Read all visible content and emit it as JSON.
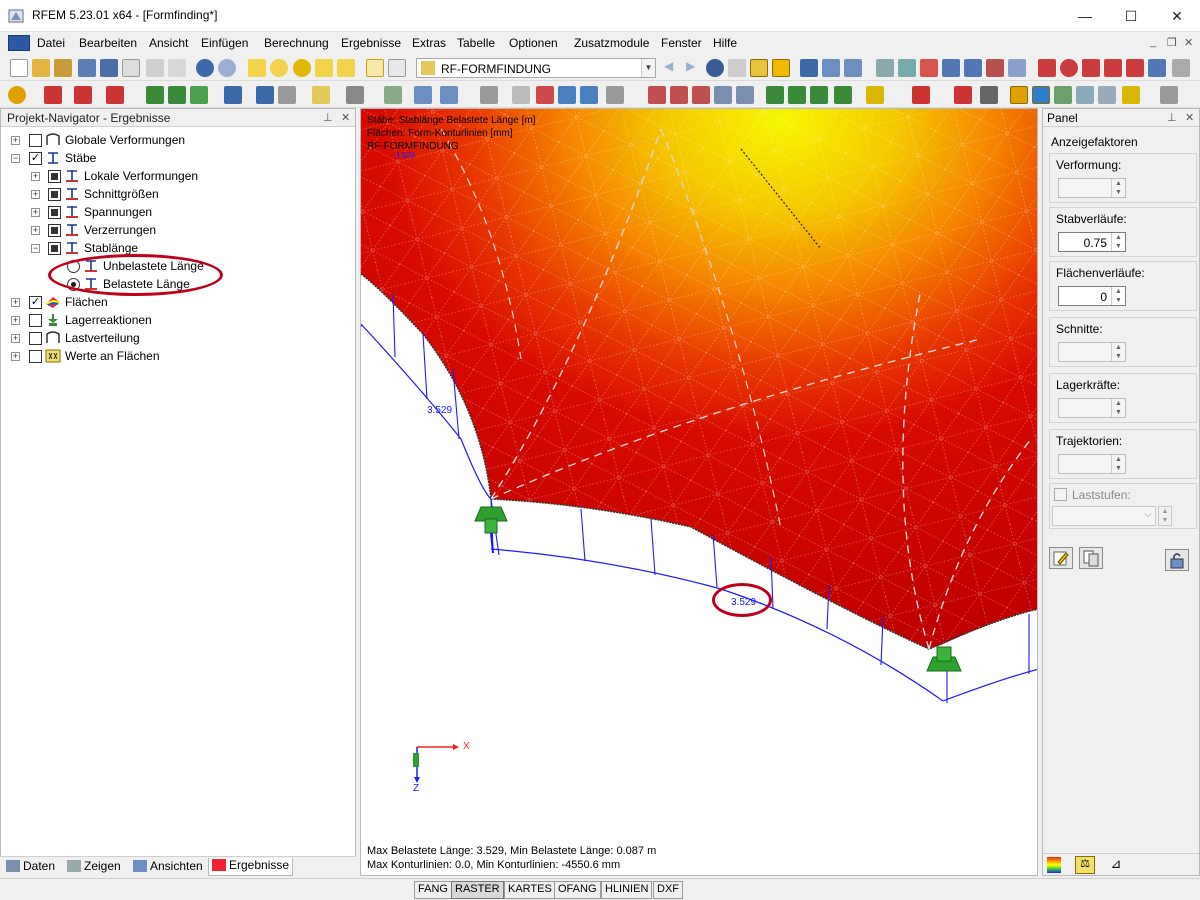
{
  "window": {
    "title": "RFEM 5.23.01 x64 - [Formfinding*]",
    "minimize": "—",
    "maximize": "☐",
    "close": "✕"
  },
  "menu": {
    "items": [
      "Datei",
      "Bearbeiten",
      "Ansicht",
      "Einfügen",
      "Berechnung",
      "Ergebnisse",
      "Extras",
      "Tabelle",
      "Optionen",
      "Zusatzmodule",
      "Fenster",
      "Hilfe"
    ]
  },
  "toolbar": {
    "module_combo": "RF-FORMFINDUNG"
  },
  "navigator": {
    "title": "Projekt-Navigator - Ergebnisse",
    "items": [
      {
        "label": "Globale Verformungen"
      },
      {
        "label": "Stäbe"
      },
      {
        "label": "Lokale Verformungen"
      },
      {
        "label": "Schnittgrößen"
      },
      {
        "label": "Spannungen"
      },
      {
        "label": "Verzerrungen"
      },
      {
        "label": "Stablänge"
      },
      {
        "label": "Unbelastete Länge"
      },
      {
        "label": "Belastete Länge"
      },
      {
        "label": "Flächen"
      },
      {
        "label": "Lagerreaktionen"
      },
      {
        "label": "Lastverteilung"
      },
      {
        "label": "Werte an Flächen"
      }
    ],
    "tabs": [
      "Daten",
      "Zeigen",
      "Ansichten",
      "Ergebnisse"
    ]
  },
  "viewport": {
    "info_lines": [
      "Stäbe: Stablänge Belastete Länge [m]",
      "Flächen: Form-Konturlinien [mm]",
      "RF-FORMFINDUNG"
    ],
    "info_small": "3.529",
    "value_label_1": "3.529",
    "value_label_2": "3.529",
    "axis_x": "X",
    "axis_z": "Z",
    "stat_line_1": "Max Belastete Länge: 3.529, Min Belastete Länge: 0.087 m",
    "stat_line_2": "Max Konturlinien: 0.0, Min Konturlinien: -4550.6 mm"
  },
  "panel": {
    "title": "Panel",
    "subtitle": "Anzeigefaktoren",
    "groups": [
      {
        "label": "Verformung:",
        "value": ""
      },
      {
        "label": "Stabverläufe:",
        "value": "0.75"
      },
      {
        "label": "Flächenverläufe:",
        "value": "0"
      },
      {
        "label": "Schnitte:",
        "value": ""
      },
      {
        "label": "Lagerkräfte:",
        "value": ""
      },
      {
        "label": "Trajektorien:",
        "value": ""
      },
      {
        "label": "Laststufen:",
        "value": ""
      }
    ]
  },
  "statusbar": {
    "items": [
      "FANG",
      "RASTER",
      "KARTES",
      "OFANG",
      "HLINIEN",
      "DXF"
    ]
  },
  "colors": {
    "accent_highlight": "#c0001a",
    "surface_red": "#d40000",
    "surface_yellow": "#f0f000",
    "member_blue": "#1a1aff"
  }
}
